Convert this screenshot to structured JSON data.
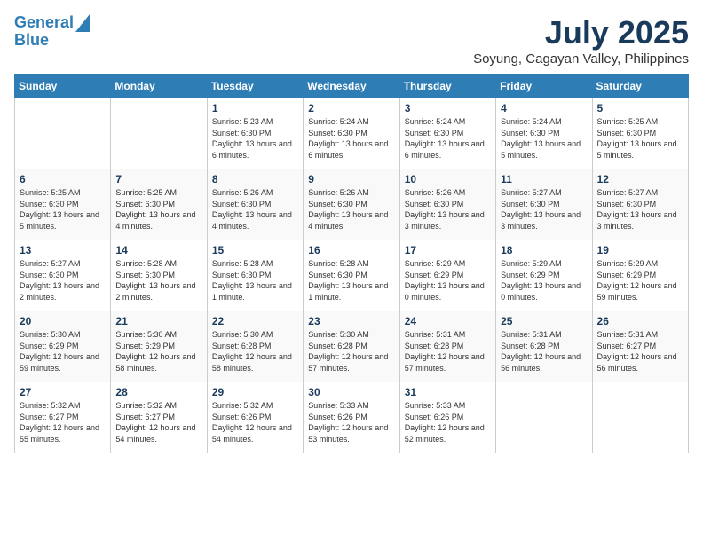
{
  "logo": {
    "line1": "General",
    "line2": "Blue"
  },
  "title": "July 2025",
  "location": "Soyung, Cagayan Valley, Philippines",
  "weekdays": [
    "Sunday",
    "Monday",
    "Tuesday",
    "Wednesday",
    "Thursday",
    "Friday",
    "Saturday"
  ],
  "weeks": [
    [
      {
        "day": "",
        "info": ""
      },
      {
        "day": "",
        "info": ""
      },
      {
        "day": "1",
        "info": "Sunrise: 5:23 AM\nSunset: 6:30 PM\nDaylight: 13 hours and 6 minutes."
      },
      {
        "day": "2",
        "info": "Sunrise: 5:24 AM\nSunset: 6:30 PM\nDaylight: 13 hours and 6 minutes."
      },
      {
        "day": "3",
        "info": "Sunrise: 5:24 AM\nSunset: 6:30 PM\nDaylight: 13 hours and 6 minutes."
      },
      {
        "day": "4",
        "info": "Sunrise: 5:24 AM\nSunset: 6:30 PM\nDaylight: 13 hours and 5 minutes."
      },
      {
        "day": "5",
        "info": "Sunrise: 5:25 AM\nSunset: 6:30 PM\nDaylight: 13 hours and 5 minutes."
      }
    ],
    [
      {
        "day": "6",
        "info": "Sunrise: 5:25 AM\nSunset: 6:30 PM\nDaylight: 13 hours and 5 minutes."
      },
      {
        "day": "7",
        "info": "Sunrise: 5:25 AM\nSunset: 6:30 PM\nDaylight: 13 hours and 4 minutes."
      },
      {
        "day": "8",
        "info": "Sunrise: 5:26 AM\nSunset: 6:30 PM\nDaylight: 13 hours and 4 minutes."
      },
      {
        "day": "9",
        "info": "Sunrise: 5:26 AM\nSunset: 6:30 PM\nDaylight: 13 hours and 4 minutes."
      },
      {
        "day": "10",
        "info": "Sunrise: 5:26 AM\nSunset: 6:30 PM\nDaylight: 13 hours and 3 minutes."
      },
      {
        "day": "11",
        "info": "Sunrise: 5:27 AM\nSunset: 6:30 PM\nDaylight: 13 hours and 3 minutes."
      },
      {
        "day": "12",
        "info": "Sunrise: 5:27 AM\nSunset: 6:30 PM\nDaylight: 13 hours and 3 minutes."
      }
    ],
    [
      {
        "day": "13",
        "info": "Sunrise: 5:27 AM\nSunset: 6:30 PM\nDaylight: 13 hours and 2 minutes."
      },
      {
        "day": "14",
        "info": "Sunrise: 5:28 AM\nSunset: 6:30 PM\nDaylight: 13 hours and 2 minutes."
      },
      {
        "day": "15",
        "info": "Sunrise: 5:28 AM\nSunset: 6:30 PM\nDaylight: 13 hours and 1 minute."
      },
      {
        "day": "16",
        "info": "Sunrise: 5:28 AM\nSunset: 6:30 PM\nDaylight: 13 hours and 1 minute."
      },
      {
        "day": "17",
        "info": "Sunrise: 5:29 AM\nSunset: 6:29 PM\nDaylight: 13 hours and 0 minutes."
      },
      {
        "day": "18",
        "info": "Sunrise: 5:29 AM\nSunset: 6:29 PM\nDaylight: 13 hours and 0 minutes."
      },
      {
        "day": "19",
        "info": "Sunrise: 5:29 AM\nSunset: 6:29 PM\nDaylight: 12 hours and 59 minutes."
      }
    ],
    [
      {
        "day": "20",
        "info": "Sunrise: 5:30 AM\nSunset: 6:29 PM\nDaylight: 12 hours and 59 minutes."
      },
      {
        "day": "21",
        "info": "Sunrise: 5:30 AM\nSunset: 6:29 PM\nDaylight: 12 hours and 58 minutes."
      },
      {
        "day": "22",
        "info": "Sunrise: 5:30 AM\nSunset: 6:28 PM\nDaylight: 12 hours and 58 minutes."
      },
      {
        "day": "23",
        "info": "Sunrise: 5:30 AM\nSunset: 6:28 PM\nDaylight: 12 hours and 57 minutes."
      },
      {
        "day": "24",
        "info": "Sunrise: 5:31 AM\nSunset: 6:28 PM\nDaylight: 12 hours and 57 minutes."
      },
      {
        "day": "25",
        "info": "Sunrise: 5:31 AM\nSunset: 6:28 PM\nDaylight: 12 hours and 56 minutes."
      },
      {
        "day": "26",
        "info": "Sunrise: 5:31 AM\nSunset: 6:27 PM\nDaylight: 12 hours and 56 minutes."
      }
    ],
    [
      {
        "day": "27",
        "info": "Sunrise: 5:32 AM\nSunset: 6:27 PM\nDaylight: 12 hours and 55 minutes."
      },
      {
        "day": "28",
        "info": "Sunrise: 5:32 AM\nSunset: 6:27 PM\nDaylight: 12 hours and 54 minutes."
      },
      {
        "day": "29",
        "info": "Sunrise: 5:32 AM\nSunset: 6:26 PM\nDaylight: 12 hours and 54 minutes."
      },
      {
        "day": "30",
        "info": "Sunrise: 5:33 AM\nSunset: 6:26 PM\nDaylight: 12 hours and 53 minutes."
      },
      {
        "day": "31",
        "info": "Sunrise: 5:33 AM\nSunset: 6:26 PM\nDaylight: 12 hours and 52 minutes."
      },
      {
        "day": "",
        "info": ""
      },
      {
        "day": "",
        "info": ""
      }
    ]
  ]
}
